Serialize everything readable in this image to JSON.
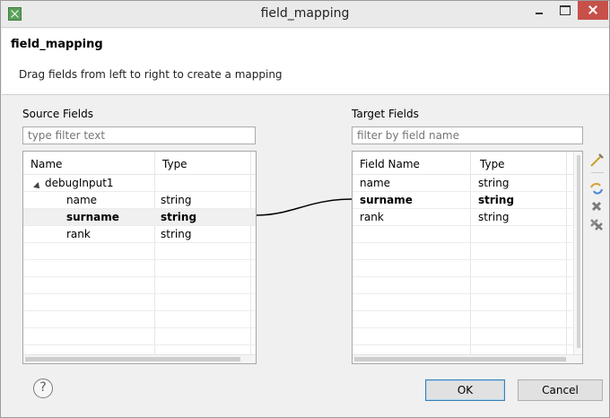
{
  "window": {
    "title": "field_mapping"
  },
  "header": {
    "title": "field_mapping",
    "description": "Drag fields from left to right to create a mapping"
  },
  "source": {
    "label": "Source Fields",
    "filter_placeholder": "type filter text",
    "columns": {
      "name": "Name",
      "type": "Type"
    },
    "root": "debugInput1",
    "rows": [
      {
        "name": "name",
        "type": "string"
      },
      {
        "name": "surname",
        "type": "string"
      },
      {
        "name": "rank",
        "type": "string"
      }
    ]
  },
  "target": {
    "label": "Target Fields",
    "filter_placeholder": "filter by field name",
    "columns": {
      "name": "Field Name",
      "type": "Type"
    },
    "rows": [
      {
        "name": "name",
        "type": "string"
      },
      {
        "name": "surname",
        "type": "string"
      },
      {
        "name": "rank",
        "type": "string"
      }
    ]
  },
  "side_icons": [
    "auto-map-icon",
    "map-selected-icon",
    "delete-icon",
    "delete-all-icon"
  ],
  "footer": {
    "help": "?",
    "ok": "OK",
    "cancel": "Cancel"
  },
  "colors": {
    "close_button": "#c7504a",
    "link_line": "#000000",
    "selected_row": "#f0f0f0"
  }
}
